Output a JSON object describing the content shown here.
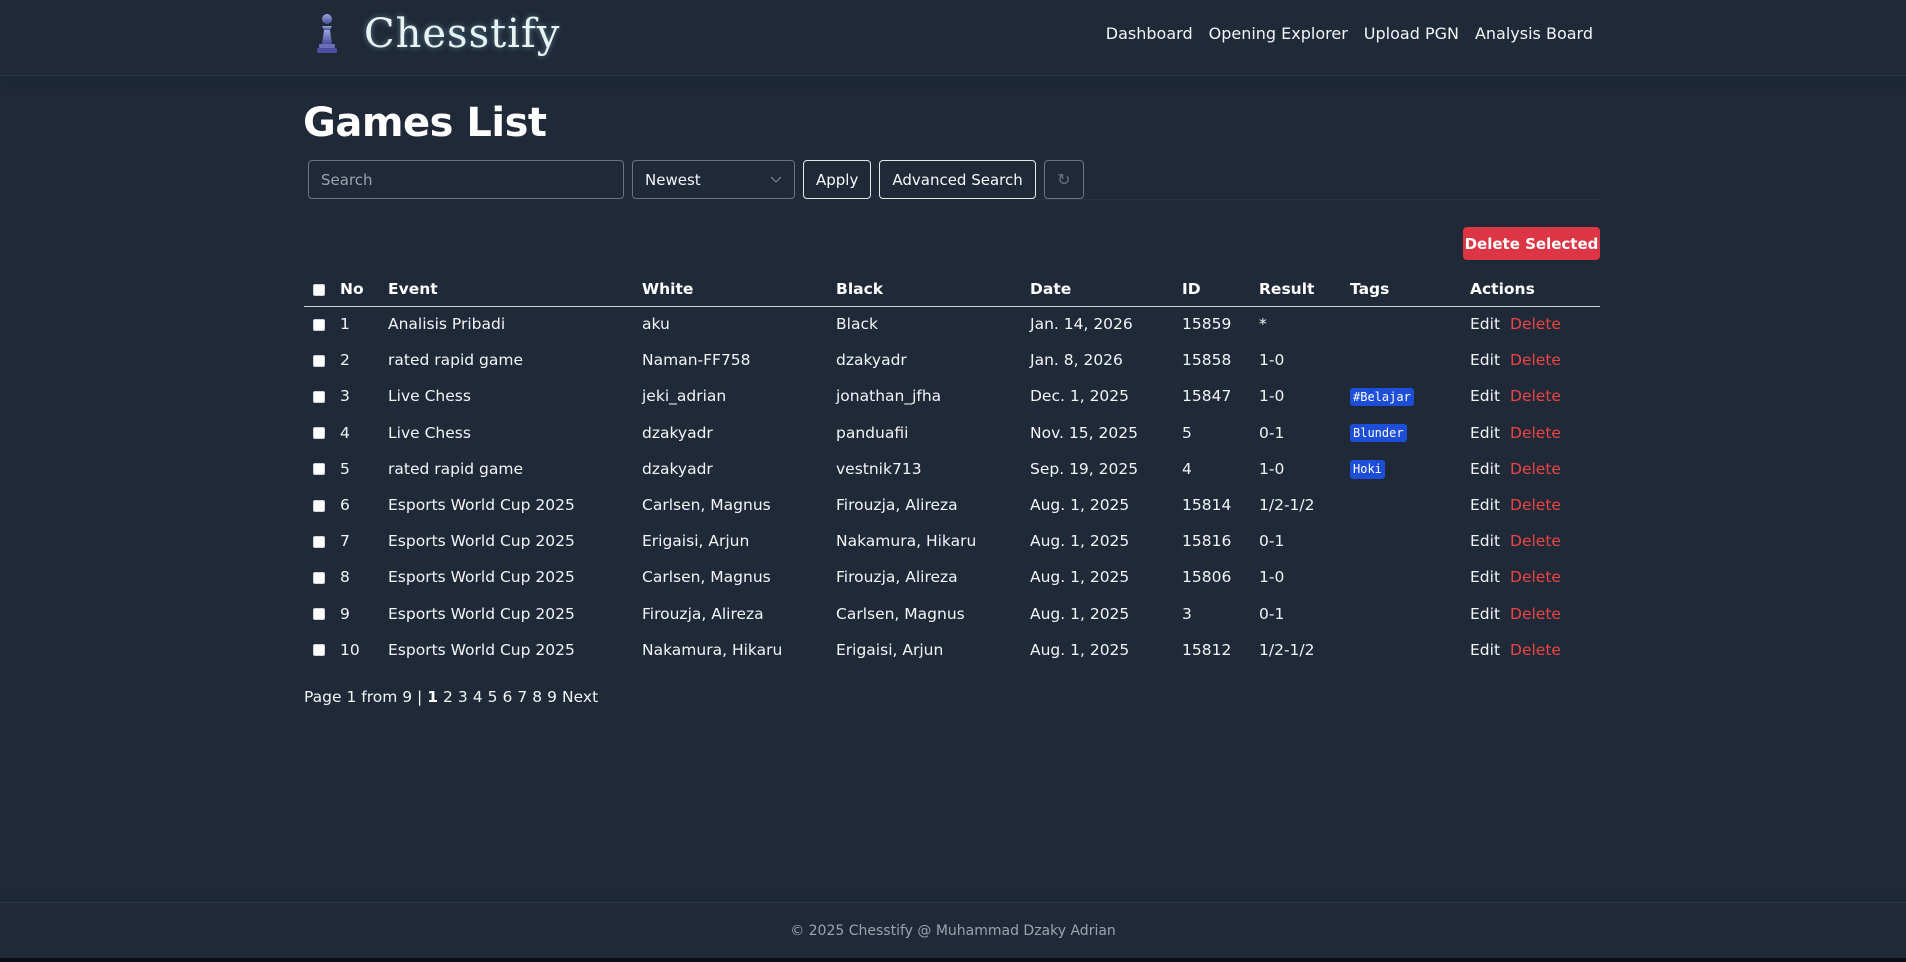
{
  "header": {
    "brand": "Chesstify",
    "nav": [
      "Dashboard",
      "Opening Explorer",
      "Upload PGN",
      "Analysis Board"
    ]
  },
  "main": {
    "title": "Games List",
    "search_placeholder": "Search",
    "sort_selected": "Newest",
    "apply_label": "Apply",
    "advanced_search_label": "Advanced Search",
    "refresh_icon": "↻",
    "delete_selected_label": "Delete Selected"
  },
  "table": {
    "headers": {
      "no": "No",
      "event": "Event",
      "white": "White",
      "black": "Black",
      "date": "Date",
      "id": "ID",
      "result": "Result",
      "tags": "Tags",
      "actions": "Actions"
    },
    "edit_label": "Edit",
    "delete_label": "Delete",
    "rows": [
      {
        "no": "1",
        "event": "Analisis Pribadi",
        "white": "aku",
        "black": "Black",
        "date": "Jan. 14, 2026",
        "id": "15859",
        "result": "*",
        "tag": ""
      },
      {
        "no": "2",
        "event": "rated rapid game",
        "white": "Naman-FF758",
        "black": "dzakyadr",
        "date": "Jan. 8, 2026",
        "id": "15858",
        "result": "1-0",
        "tag": ""
      },
      {
        "no": "3",
        "event": "Live Chess",
        "white": "jeki_adrian",
        "black": "jonathan_jfha",
        "date": "Dec. 1, 2025",
        "id": "15847",
        "result": "1-0",
        "tag": "#Belajar"
      },
      {
        "no": "4",
        "event": "Live Chess",
        "white": "dzakyadr",
        "black": "panduafii",
        "date": "Nov. 15, 2025",
        "id": "5",
        "result": "0-1",
        "tag": "Blunder"
      },
      {
        "no": "5",
        "event": "rated rapid game",
        "white": "dzakyadr",
        "black": "vestnik713",
        "date": "Sep. 19, 2025",
        "id": "4",
        "result": "1-0",
        "tag": "Hoki"
      },
      {
        "no": "6",
        "event": "Esports World Cup 2025",
        "white": "Carlsen, Magnus",
        "black": "Firouzja, Alireza",
        "date": "Aug. 1, 2025",
        "id": "15814",
        "result": "1/2-1/2",
        "tag": ""
      },
      {
        "no": "7",
        "event": "Esports World Cup 2025",
        "white": "Erigaisi, Arjun",
        "black": "Nakamura, Hikaru",
        "date": "Aug. 1, 2025",
        "id": "15816",
        "result": "0-1",
        "tag": ""
      },
      {
        "no": "8",
        "event": "Esports World Cup 2025",
        "white": "Carlsen, Magnus",
        "black": "Firouzja, Alireza",
        "date": "Aug. 1, 2025",
        "id": "15806",
        "result": "1-0",
        "tag": ""
      },
      {
        "no": "9",
        "event": "Esports World Cup 2025",
        "white": "Firouzja, Alireza",
        "black": "Carlsen, Magnus",
        "date": "Aug. 1, 2025",
        "id": "3",
        "result": "0-1",
        "tag": ""
      },
      {
        "no": "10",
        "event": "Esports World Cup 2025",
        "white": "Nakamura, Hikaru",
        "black": "Erigaisi, Arjun",
        "date": "Aug. 1, 2025",
        "id": "15812",
        "result": "1/2-1/2",
        "tag": ""
      }
    ]
  },
  "pagination": {
    "summary": "Page 1 from 9 |",
    "pages": [
      "1",
      "2",
      "3",
      "4",
      "5",
      "6",
      "7",
      "8",
      "9"
    ],
    "current": "1",
    "next_label": "Next"
  },
  "footer": {
    "text": "© 2025 Chesstify @ Muhammad Dzaky Adrian"
  },
  "colors": {
    "background": "#1f2937",
    "danger": "#dc3545",
    "delete_link": "#ef4444",
    "tag": "#1d4ed8"
  },
  "icons": {
    "logo": "chess-pawn-icon",
    "select": "chevron-down-icon",
    "refresh": "refresh-icon"
  }
}
